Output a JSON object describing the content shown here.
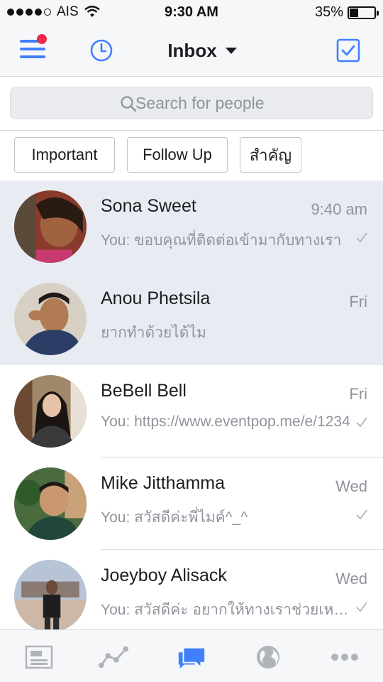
{
  "status_bar": {
    "signal_filled": 4,
    "signal_total": 5,
    "carrier": "AIS",
    "time": "9:30 AM",
    "battery_percent_label": "35%",
    "battery_level": 0.35
  },
  "nav": {
    "title": "Inbox",
    "menu_icon": "hamburger-menu-icon",
    "history_icon": "clock-icon",
    "title_caret_icon": "caret-down-icon",
    "select_icon": "checkbox-icon",
    "accent_color": "#4080ff",
    "badge_color": "#f02849"
  },
  "search": {
    "placeholder": "Search for people",
    "value": ""
  },
  "filters": [
    "Important",
    "Follow Up",
    "สำคัญ"
  ],
  "conversations": [
    {
      "name": "Sona Sweet",
      "time": "9:40 am",
      "preview": "You: ขอบคุณที่ติดต่อเข้ามากับทางเรา",
      "unread": true,
      "seen": true
    },
    {
      "name": "Anou Phetsila",
      "time": "Fri",
      "preview": "ยากทำด้วยได้ไม",
      "unread": true,
      "seen": false
    },
    {
      "name": "BeBell Bell",
      "time": "Fri",
      "preview": "You: https://www.eventpop.me/e/1234",
      "unread": false,
      "seen": true
    },
    {
      "name": "Mike Jitthamma",
      "time": "Wed",
      "preview": "You: สวัสดีค่ะพี่ไมค์^_^",
      "unread": false,
      "seen": true
    },
    {
      "name": "Joeyboy Alisack",
      "time": "Wed",
      "preview": "You: สวัสดีค่ะ อยากให้ทางเราช่วยเหลืออะไรคะ",
      "unread": false,
      "seen": true
    }
  ],
  "tabs": [
    {
      "icon": "news-feed-icon",
      "active": false
    },
    {
      "icon": "insights-chart-icon",
      "active": false
    },
    {
      "icon": "messages-icon",
      "active": true
    },
    {
      "icon": "globe-icon",
      "active": false
    },
    {
      "icon": "more-icon",
      "active": false
    }
  ]
}
